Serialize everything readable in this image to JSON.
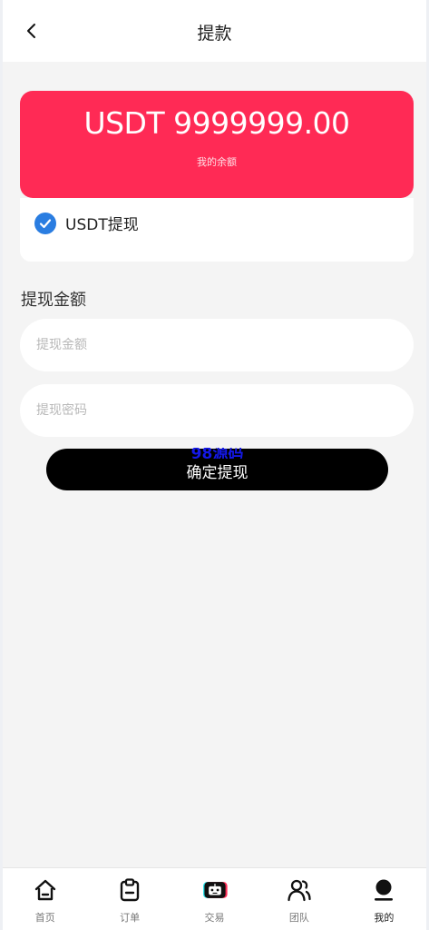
{
  "header": {
    "title": "提款"
  },
  "balance": {
    "amount": "USDT 9999999.00",
    "label": "我的余额"
  },
  "method": {
    "label": "USDT提现",
    "selected": true
  },
  "form": {
    "section_title": "提现金额",
    "amount_placeholder": "提现金额",
    "password_placeholder": "提现密码",
    "submit_label": "确定提现",
    "overlay_text": "98源码"
  },
  "tabs": [
    {
      "label": "首页",
      "icon": "home-icon"
    },
    {
      "label": "订单",
      "icon": "clipboard-icon"
    },
    {
      "label": "交易",
      "icon": "robot-icon"
    },
    {
      "label": "团队",
      "icon": "team-icon"
    },
    {
      "label": "我的",
      "icon": "user-icon",
      "active": true
    }
  ],
  "colors": {
    "accent": "#ff2a55",
    "check": "#2a7de1",
    "button": "#000000"
  }
}
